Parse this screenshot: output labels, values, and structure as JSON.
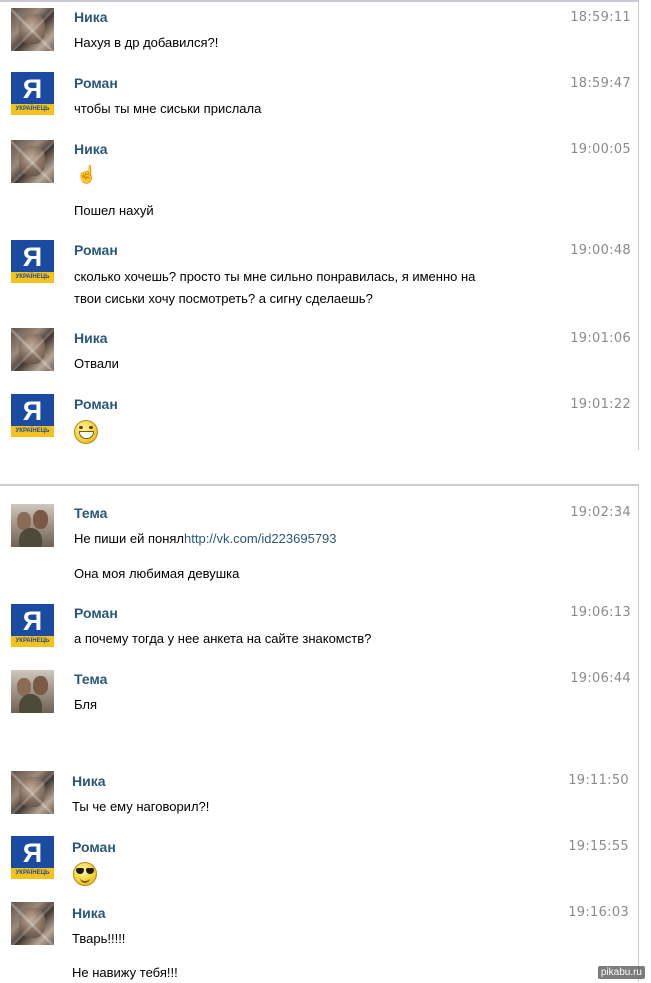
{
  "chat1": {
    "messages": [
      {
        "author": "Ника",
        "time": "18:59:11",
        "text": "Нахуя в др добавился?!"
      },
      {
        "author": "Роман",
        "time": "18:59:47",
        "text": "чтобы ты мне сиськи прислала"
      },
      {
        "author": "Ника",
        "time": "19:00:05",
        "emoji": "pointing-hand-icon",
        "text2": "Пошел нахуй"
      },
      {
        "author": "Роман",
        "time": "19:00:48",
        "text": "сколько хочешь? просто ты мне сильно понравилась, я именно на",
        "text_line2": "твои сиськи хочу посмотреть? а сигну сделаешь?"
      },
      {
        "author": "Ника",
        "time": "19:01:06",
        "text": "Отвали"
      },
      {
        "author": "Роман",
        "time": "19:01:22",
        "emoji": "grinning-face-icon"
      }
    ]
  },
  "chat2": {
    "messages": [
      {
        "author": "Тема",
        "time": "19:02:34",
        "text_prefix": "Не пиши ей понял",
        "link": "http://vk.com/id223695793",
        "text2": "Она моя любимая девушка"
      },
      {
        "author": "Роман",
        "time": "19:06:13",
        "text": "а почему тогда у нее анкета на сайте знакомств?"
      },
      {
        "author": "Тема",
        "time": "19:06:44",
        "text": "Бля"
      },
      {
        "author": "Ника",
        "time": "19:11:50",
        "text": "Ты че ему наговорил?!"
      },
      {
        "author": "Роман",
        "time": "19:15:55",
        "emoji": "sunglasses-face-icon"
      },
      {
        "author": "Ника",
        "time": "19:16:03",
        "text": "Тварь!!!!!",
        "text2": "Не навижу тебя!!!"
      }
    ]
  },
  "avatar_labels": {
    "roman_letter": "Я",
    "roman_strip": "УКРАЇНЕЦЬ"
  },
  "watermark": "pikabu.ru",
  "colors": {
    "name": "#2b587a",
    "time": "#8b8b8b",
    "divider": "#c9cdd2"
  }
}
